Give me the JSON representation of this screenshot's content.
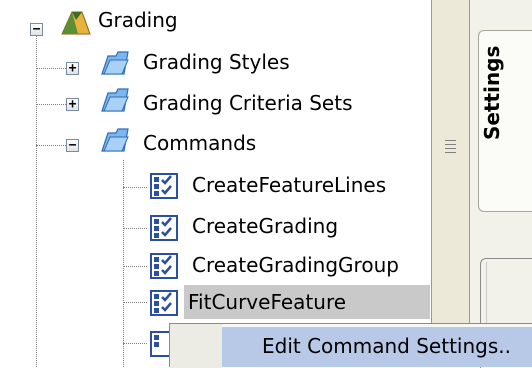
{
  "tree": {
    "root": {
      "label": "Grading",
      "toggle": "−"
    },
    "children": [
      {
        "label": "Grading Styles",
        "toggle": "+"
      },
      {
        "label": "Grading Criteria Sets",
        "toggle": "+"
      },
      {
        "label": "Commands",
        "toggle": "−"
      }
    ],
    "commands": [
      {
        "label": "CreateFeatureLines"
      },
      {
        "label": "CreateGrading"
      },
      {
        "label": "CreateGradingGroup"
      },
      {
        "label": "FitCurveFeature"
      }
    ]
  },
  "panel": {
    "tab_label": "Settings"
  },
  "context_menu": {
    "item_label": "Edit Command Settings.."
  },
  "colors": {
    "selection": "#c9c9c9",
    "menu_highlight": "#b8c9e8",
    "folder": "#6aa7e8",
    "root_icon": "#5a8f32"
  }
}
